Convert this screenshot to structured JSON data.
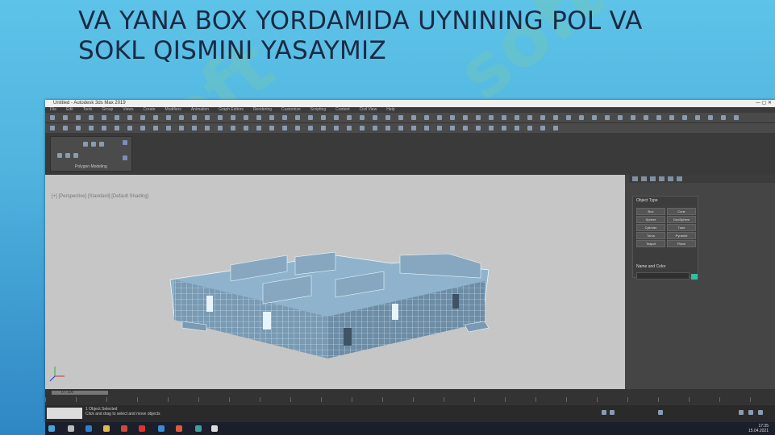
{
  "slide": {
    "title_line1": "VA YANA BOX YORDAMIDA UYNINING POL VA",
    "title_line2": "SOKL QISMINI YASAYMIZ"
  },
  "watermark": {
    "text": "soft"
  },
  "app": {
    "window_title": "Untitled - Autodesk 3ds Max 2019",
    "menu": [
      "File",
      "Edit",
      "Tools",
      "Group",
      "Views",
      "Create",
      "Modifiers",
      "Animation",
      "Graph Editors",
      "Rendering",
      "Customize",
      "Scripting",
      "Content",
      "Civil View",
      "Help"
    ],
    "ribbon_label": "Polygon Modeling",
    "viewport_label": "[+] [Perspective] [Standard] [Default Shading]",
    "command_panel": {
      "rollout_title": "Object Type",
      "buttons": [
        "Box",
        "Cone",
        "Sphere",
        "GeoSphere",
        "Cylinder",
        "Tube",
        "Torus",
        "Pyramid",
        "Teapot",
        "Plane"
      ],
      "name_color_title": "Name and Color"
    },
    "timeline": {
      "frame": "0 / 100"
    },
    "status": {
      "line1": "1 Object Selected",
      "line2": "Click and drag to select and move objects"
    }
  },
  "taskbar": {
    "time": "17:35",
    "date": "15.04.2021"
  },
  "colors": {
    "accent": "#2ec0a0",
    "title_text": "#1b2a44",
    "viewport_bg": "#c6c6c6",
    "model": "#8fb3cc"
  }
}
